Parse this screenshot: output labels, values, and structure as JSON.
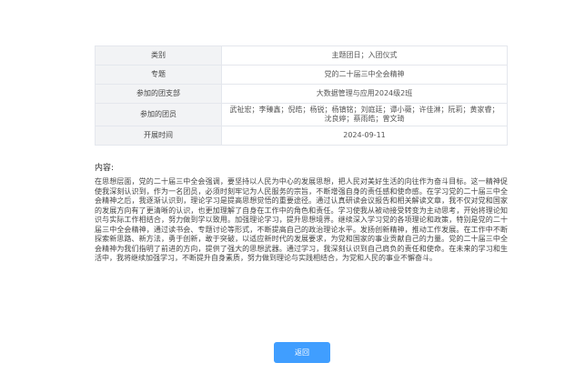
{
  "info_table": {
    "rows": [
      {
        "label": "类别",
        "value": "主题团日；入团仪式"
      },
      {
        "label": "专题",
        "value": "党的二十届三中全会精神"
      },
      {
        "label": "参加的团支部",
        "value": "大数据管理与应用2024级2班"
      },
      {
        "label": "参加的团员",
        "value": "武祉宏；李臻鑫；倪皓；杨锐；杨镇铭；刘庭廷；谭小薇；许佳淋；阮莉；黄家睿；沈良婷；蔡雨皓；曾文琦"
      },
      {
        "label": "开展时间",
        "value": "2024-09-11"
      }
    ]
  },
  "content": {
    "title": "内容:",
    "body": "在思想层面，党的二十届三中全会强调，要坚持以人民为中心的发展思想，把人民对美好生活的向往作为奋斗目标。这一精神促使我深刻认识到，作为一名团员，必须时刻牢记为人民服务的宗旨，不断增强自身的责任感和使命感。在学习党的二十届三中全会精神之后，我逐渐认识到，理论学习是提高思想觉悟的重要途径。通过认真研读会议报告和相关解读文章，我不仅对党和国家的发展方向有了更清晰的认识，也更加理解了自身在工作中的角色和责任。学习使我从被动接受转变为主动思考，开始将理论知识与实际工作相结合，努力做到学以致用。加强理论学习，提升思想境界。继续深入学习党的各项理论和政策，特别是党的二十届三中全会精神，通过读书会、专题讨论等形式，不断提高自己的政治理论水平。发扬创新精神，推动工作发展。在工作中不断探索新思路、新方法，勇于创新，敢于突破，以适应新时代的发展要求，为党和国家的事业贡献自己的力量。党的二十届三中全会精神为我们指明了前进的方向，提供了强大的思想武器。通过学习，我深刻认识到自己肩负的责任和使命。在未来的学习和生活中，我将继续加强学习，不断提升自身素质，努力做到理论与实践相结合，为党和人民的事业不懈奋斗。"
  },
  "actions": {
    "back_label": "返回"
  },
  "colors": {
    "primary": "#409eff",
    "label_bg": "#f2f3f5",
    "border": "#e4e7ed"
  }
}
